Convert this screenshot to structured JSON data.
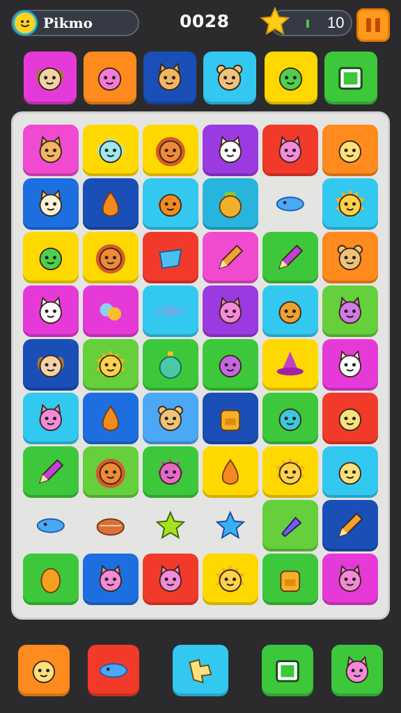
{
  "hud": {
    "player_name": "Pikmo",
    "score": "0028",
    "stars": "10",
    "avatar_icon": "smiley-face-icon",
    "star_icon": "star-icon",
    "pause_icon": "pause-icon"
  },
  "palette": {
    "pink": "#f04bd0",
    "magenta": "#e63ad8",
    "orange": "#ff8a1d",
    "blue": "#1d6fe0",
    "navy": "#1a4fb8",
    "cyan": "#33c8f0",
    "yellow": "#ffd800",
    "green": "#3cc83a",
    "lime": "#66cf3c",
    "purple": "#9b3ae0",
    "red": "#f23a2a",
    "sky": "#4aa8f5",
    "teal": "#27b5dd",
    "bare": "transparent"
  },
  "top_tray": [
    {
      "color": "magenta",
      "icon": "dog-face-icon"
    },
    {
      "color": "orange",
      "icon": "pink-blob-icon"
    },
    {
      "color": "navy",
      "icon": "cat-face-icon"
    },
    {
      "color": "cyan",
      "icon": "bear-face-icon"
    },
    {
      "color": "yellow",
      "icon": "green-slime-icon"
    },
    {
      "color": "green",
      "icon": "tv-box-icon"
    }
  ],
  "board": [
    [
      {
        "color": "pink",
        "icon": "cat-face-icon"
      },
      {
        "color": "yellow",
        "icon": "cloud-face-icon"
      },
      {
        "color": "yellow",
        "icon": "lion-face-icon"
      },
      {
        "color": "purple",
        "icon": "white-cat-icon"
      },
      {
        "color": "red",
        "icon": "pink-cat-icon"
      },
      {
        "color": "orange",
        "icon": "chick-face-icon"
      }
    ],
    [
      {
        "color": "blue",
        "icon": "fox-face-icon"
      },
      {
        "color": "navy",
        "icon": "orange-drop-icon"
      },
      {
        "color": "cyan",
        "icon": "orange-fish-icon"
      },
      {
        "color": "teal",
        "icon": "honey-pot-icon"
      },
      {
        "color": "bare",
        "icon": "blue-fish-icon"
      },
      {
        "color": "cyan",
        "icon": "sun-face-icon"
      }
    ],
    [
      {
        "color": "yellow",
        "icon": "green-slime-icon"
      },
      {
        "color": "yellow",
        "icon": "lion-face-icon"
      },
      {
        "color": "red",
        "icon": "blue-gem-icon"
      },
      {
        "color": "pink",
        "icon": "pencil-icon"
      },
      {
        "color": "green",
        "icon": "purple-pencil-icon"
      },
      {
        "color": "orange",
        "icon": "bear-face-icon"
      }
    ],
    [
      {
        "color": "magenta",
        "icon": "white-cat-icon"
      },
      {
        "color": "magenta",
        "icon": "candy-icon"
      },
      {
        "color": "cyan",
        "icon": "wrapped-candy-icon"
      },
      {
        "color": "purple",
        "icon": "pink-cat-icon"
      },
      {
        "color": "cyan",
        "icon": "acorn-face-icon"
      },
      {
        "color": "lime",
        "icon": "purple-cat-icon"
      }
    ],
    [
      {
        "color": "navy",
        "icon": "dog-face-icon"
      },
      {
        "color": "lime",
        "icon": "sun-face-icon"
      },
      {
        "color": "green",
        "icon": "potion-icon"
      },
      {
        "color": "green",
        "icon": "purple-blob-icon"
      },
      {
        "color": "yellow",
        "icon": "witch-hat-icon"
      },
      {
        "color": "magenta",
        "icon": "white-cat-icon"
      }
    ],
    [
      {
        "color": "cyan",
        "icon": "pink-cat-icon"
      },
      {
        "color": "blue",
        "icon": "orange-drop-icon"
      },
      {
        "color": "sky",
        "icon": "bear-face-icon"
      },
      {
        "color": "navy",
        "icon": "backpack-icon"
      },
      {
        "color": "green",
        "icon": "teal-bubble-icon"
      },
      {
        "color": "red",
        "icon": "chick-face-icon"
      }
    ],
    [
      {
        "color": "green",
        "icon": "purple-pencil-icon"
      },
      {
        "color": "lime",
        "icon": "lion-face-icon"
      },
      {
        "color": "green",
        "icon": "pink-spiky-icon"
      },
      {
        "color": "yellow",
        "icon": "orange-drop-icon"
      },
      {
        "color": "yellow",
        "icon": "sun-face-icon"
      },
      {
        "color": "cyan",
        "icon": "chick-face-icon"
      }
    ],
    [
      {
        "color": "bare",
        "icon": "blue-fish-icon"
      },
      {
        "color": "bare",
        "icon": "pie-icon"
      },
      {
        "color": "bare",
        "icon": "green-star-icon"
      },
      {
        "color": "bare",
        "icon": "blue-star-icon"
      },
      {
        "color": "lime",
        "icon": "blue-cone-icon"
      },
      {
        "color": "navy",
        "icon": "pencil-icon"
      }
    ],
    [
      {
        "color": "green",
        "icon": "orange-egg-icon"
      },
      {
        "color": "blue",
        "icon": "pink-cat-icon"
      },
      {
        "color": "red",
        "icon": "pink-cat-icon"
      },
      {
        "color": "yellow",
        "icon": "sun-face-icon"
      },
      {
        "color": "green",
        "icon": "backpack-icon"
      },
      {
        "color": "magenta",
        "icon": "pink-cat-icon"
      }
    ]
  ],
  "bottom_tray": [
    {
      "color": "orange",
      "icon": "chick-face-icon"
    },
    {
      "color": "red",
      "icon": "blue-fish-icon"
    },
    {
      "color": "cyan",
      "icon": "puzzle-piece-icon"
    },
    {
      "color": "green",
      "icon": "tv-box-icon"
    },
    {
      "color": "green",
      "icon": "pink-cat-icon"
    }
  ]
}
